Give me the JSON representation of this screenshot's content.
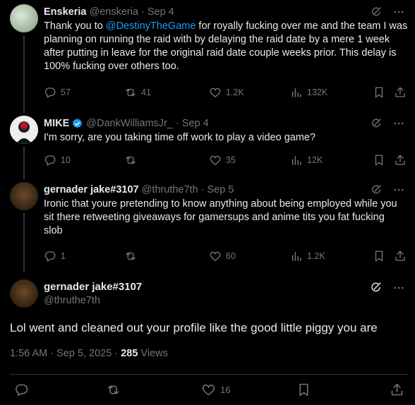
{
  "tweets": [
    {
      "name": "Enskeria",
      "handle": "@enskeria",
      "sep": "·",
      "date": "Sep 4",
      "text_before": "Thank you to ",
      "mention": "@DestinyTheGame",
      "text_after": " for royally fucking over me and the team I was planning on running the raid with by delaying the raid date by a mere 1 week after putting in leave for the original raid date couple weeks prior. This delay is 100% fucking over others too.",
      "replies": "57",
      "reposts": "41",
      "likes": "1.2K",
      "views": "132K"
    },
    {
      "name": "MIKE",
      "handle": "@DankWilliamsJr_",
      "sep": "·",
      "date": "Sep 4",
      "text": "I'm sorry, are you taking time off work to play a video game?",
      "replies": "10",
      "reposts": "",
      "likes": "35",
      "views": "12K",
      "verified": true
    },
    {
      "name": "gernader jake#3107",
      "handle": "@thruthe7th",
      "sep": "·",
      "date": "Sep 5",
      "text": "Ironic that youre pretending to know anything about being employed while you sit there retweeting giveaways for gamersups and anime tits you fat fucking slob",
      "replies": "1",
      "reposts": "",
      "likes": "60",
      "views": "1.2K"
    }
  ],
  "main": {
    "name": "gernader jake#3107",
    "handle": "@thruthe7th",
    "text": "Lol went and cleaned out your profile like the good little piggy you are",
    "time": "1:56 AM · Sep 5, 2025 · ",
    "views_count": "285",
    "views_label": " Views",
    "likes": "16"
  },
  "colors": {
    "accent": "#1d9bf0",
    "muted": "#71767b",
    "text": "#e7e9ea",
    "bg": "#000000"
  }
}
